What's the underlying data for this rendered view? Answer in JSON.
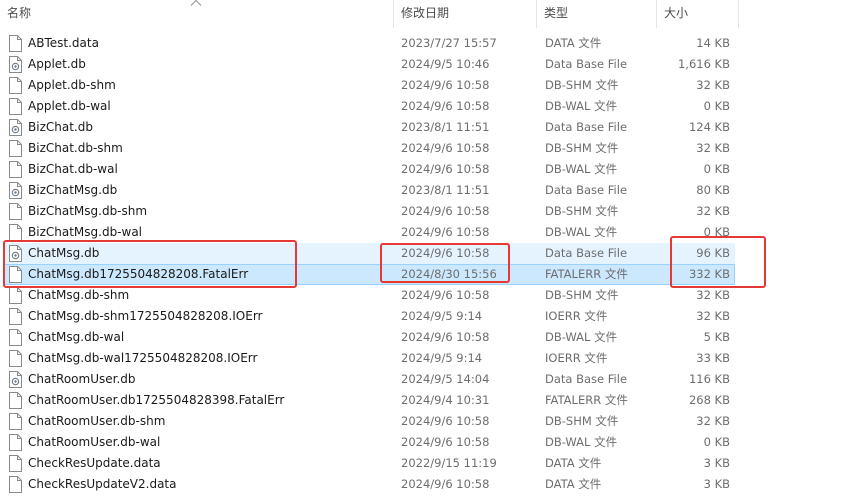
{
  "columns": {
    "name": "名称",
    "date": "修改日期",
    "type": "类型",
    "size": "大小"
  },
  "files": [
    {
      "name": "ABTest.data",
      "date": "2023/7/27 15:57",
      "type": "DATA 文件",
      "size": "14 KB",
      "icon": "file-icon"
    },
    {
      "name": "Applet.db",
      "date": "2024/9/5 10:46",
      "type": "Data Base File",
      "size": "1,616 KB",
      "icon": "database-file-icon"
    },
    {
      "name": "Applet.db-shm",
      "date": "2024/9/6 10:58",
      "type": "DB-SHM 文件",
      "size": "32 KB",
      "icon": "file-icon"
    },
    {
      "name": "Applet.db-wal",
      "date": "2024/9/6 10:58",
      "type": "DB-WAL 文件",
      "size": "0 KB",
      "icon": "file-icon"
    },
    {
      "name": "BizChat.db",
      "date": "2023/8/1 11:51",
      "type": "Data Base File",
      "size": "124 KB",
      "icon": "database-file-icon"
    },
    {
      "name": "BizChat.db-shm",
      "date": "2024/9/6 10:58",
      "type": "DB-SHM 文件",
      "size": "32 KB",
      "icon": "file-icon"
    },
    {
      "name": "BizChat.db-wal",
      "date": "2024/9/6 10:58",
      "type": "DB-WAL 文件",
      "size": "0 KB",
      "icon": "file-icon"
    },
    {
      "name": "BizChatMsg.db",
      "date": "2023/8/1 11:51",
      "type": "Data Base File",
      "size": "80 KB",
      "icon": "database-file-icon"
    },
    {
      "name": "BizChatMsg.db-shm",
      "date": "2024/9/6 10:58",
      "type": "DB-SHM 文件",
      "size": "32 KB",
      "icon": "file-icon"
    },
    {
      "name": "BizChatMsg.db-wal",
      "date": "2024/9/6 10:58",
      "type": "DB-WAL 文件",
      "size": "0 KB",
      "icon": "file-icon"
    },
    {
      "name": "ChatMsg.db",
      "date": "2024/9/6 10:58",
      "type": "Data Base File",
      "size": "96 KB",
      "icon": "database-file-icon",
      "state": "hover"
    },
    {
      "name": "ChatMsg.db1725504828208.FatalErr",
      "date": "2024/8/30 15:56",
      "type": "FATALERR 文件",
      "size": "332 KB",
      "icon": "file-icon",
      "state": "selected"
    },
    {
      "name": "ChatMsg.db-shm",
      "date": "2024/9/6 10:58",
      "type": "DB-SHM 文件",
      "size": "32 KB",
      "icon": "file-icon"
    },
    {
      "name": "ChatMsg.db-shm1725504828208.IOErr",
      "date": "2024/9/5 9:14",
      "type": "IOERR 文件",
      "size": "32 KB",
      "icon": "file-icon"
    },
    {
      "name": "ChatMsg.db-wal",
      "date": "2024/9/6 10:58",
      "type": "DB-WAL 文件",
      "size": "5 KB",
      "icon": "file-icon"
    },
    {
      "name": "ChatMsg.db-wal1725504828208.IOErr",
      "date": "2024/9/5 9:14",
      "type": "IOERR 文件",
      "size": "33 KB",
      "icon": "file-icon"
    },
    {
      "name": "ChatRoomUser.db",
      "date": "2024/9/5 14:04",
      "type": "Data Base File",
      "size": "116 KB",
      "icon": "database-file-icon"
    },
    {
      "name": "ChatRoomUser.db1725504828398.FatalErr",
      "date": "2024/9/4 10:31",
      "type": "FATALERR 文件",
      "size": "268 KB",
      "icon": "file-icon"
    },
    {
      "name": "ChatRoomUser.db-shm",
      "date": "2024/9/6 10:58",
      "type": "DB-SHM 文件",
      "size": "32 KB",
      "icon": "file-icon"
    },
    {
      "name": "ChatRoomUser.db-wal",
      "date": "2024/9/6 10:58",
      "type": "DB-WAL 文件",
      "size": "0 KB",
      "icon": "file-icon"
    },
    {
      "name": "CheckResUpdate.data",
      "date": "2022/9/15 11:19",
      "type": "DATA 文件",
      "size": "3 KB",
      "icon": "file-icon"
    },
    {
      "name": "CheckResUpdateV2.data",
      "date": "2024/9/6 10:58",
      "type": "DATA 文件",
      "size": "3 KB",
      "icon": "file-icon"
    }
  ],
  "colors": {
    "hover": "#e5f3ff",
    "selected": "#cce8ff",
    "selected_border": "#99d1ff",
    "annotation": "#e53935"
  }
}
